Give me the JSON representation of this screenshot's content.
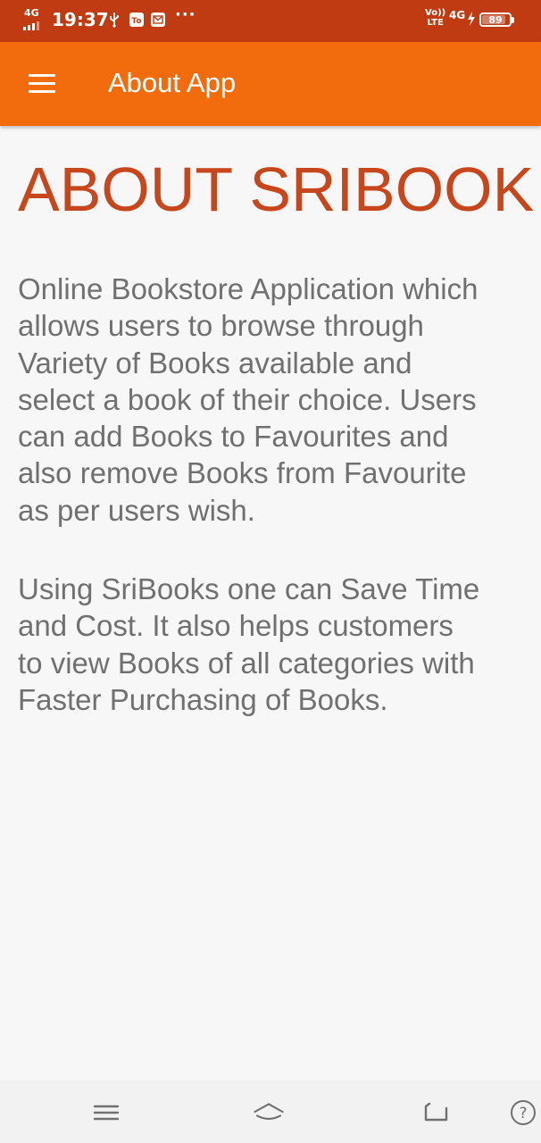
{
  "status_bar": {
    "network_left": "4G",
    "time": "19:37",
    "volte_line1": "Vo))",
    "volte_line2": "LTE",
    "network_right": "4G",
    "battery_percent": "89",
    "battery_level": 0.89,
    "icons": [
      "signal-icon",
      "usb-icon",
      "notification-app-icon",
      "mail-icon",
      "more-notifications-icon",
      "charging-icon",
      "battery-icon"
    ]
  },
  "app_bar": {
    "title": "About App",
    "menu_icon": "hamburger-menu-icon",
    "background": "#f26c0d"
  },
  "content": {
    "heading": "ABOUT SRIBOOK",
    "paragraph1": "Online Bookstore Application which\nallows users to browse through\nVariety of Books available and\nselect a book of their choice. Users\ncan add Books to Favourites and\nalso remove Books from Favourite\nas per users wish.",
    "paragraph2": "Using SriBooks one can Save Time\nand Cost. It also helps customers\nto view Books of all categories with\nFaster Purchasing of Books.",
    "heading_color": "#c8461b",
    "text_color": "#707070"
  },
  "nav_bar": {
    "icons": [
      "recents-icon",
      "home-icon",
      "back-icon",
      "help-icon"
    ]
  },
  "colors": {
    "status_bar": "#c13b12",
    "app_bar": "#f26c0d",
    "background": "#f7f7f7"
  }
}
